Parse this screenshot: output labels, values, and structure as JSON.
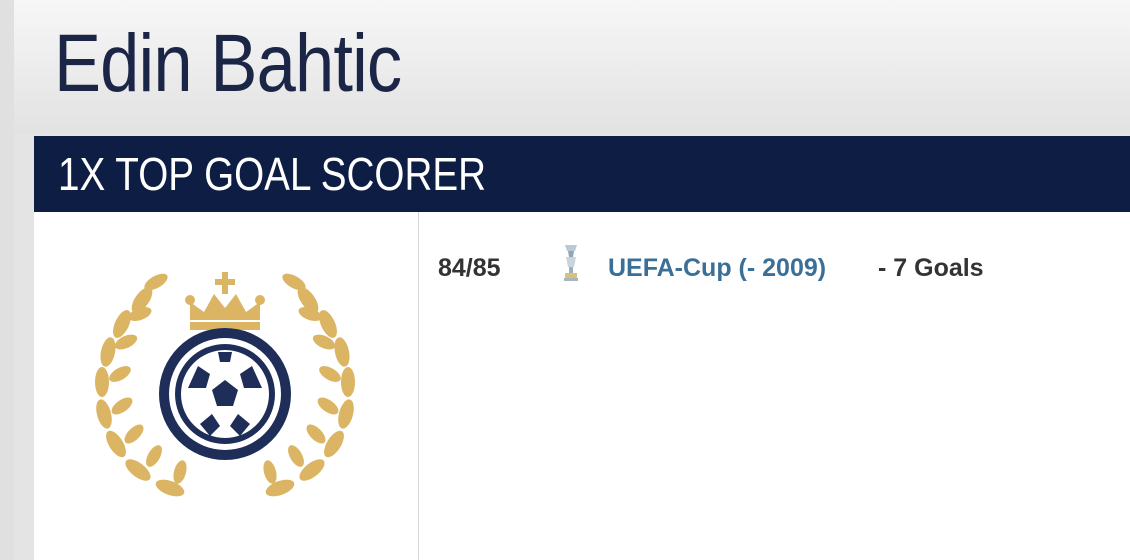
{
  "player": {
    "name": "Edin Bahtic"
  },
  "award": {
    "title": "1X TOP GOAL SCORER",
    "logo_icon": "laurel-crown-football-icon",
    "entries": [
      {
        "season": "84/85",
        "competition_icon": "uefa-cup-trophy-icon",
        "competition": "UEFA-Cup (- 2009)",
        "goals_text": "- 7 Goals"
      }
    ]
  },
  "colors": {
    "header_bar": "#0d1d44",
    "name_text": "#1b2546",
    "link": "#3a6f98",
    "laurel_gold": "#d9b35c"
  }
}
